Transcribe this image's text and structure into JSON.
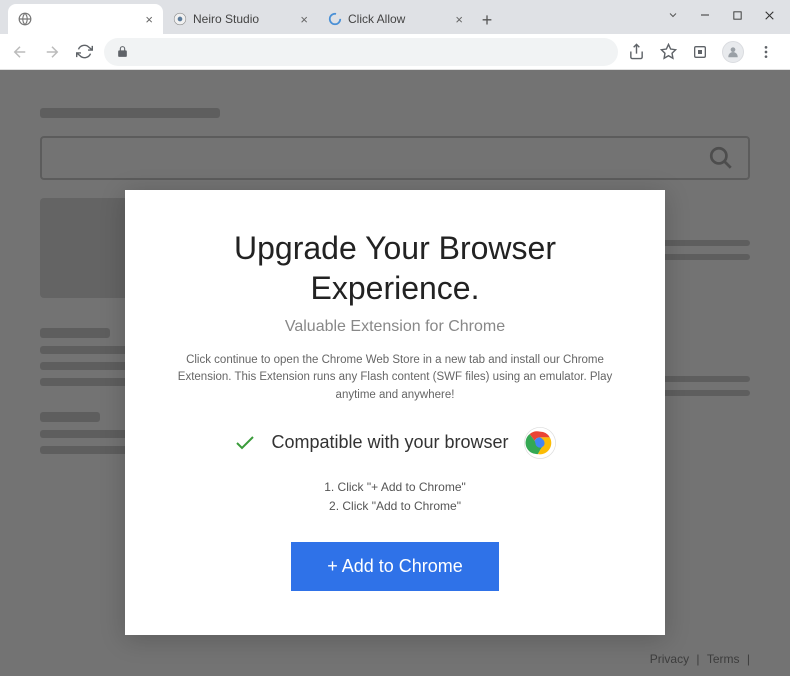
{
  "tabs": [
    {
      "title": "",
      "active": true
    },
    {
      "title": "Neiro Studio",
      "active": false
    },
    {
      "title": "Click Allow",
      "active": false
    }
  ],
  "modal": {
    "heading": "Upgrade Your Browser Experience.",
    "subheading": "Valuable Extension for Chrome",
    "description": "Click continue to open the Chrome Web Store in a new tab and install our Chrome Extension. This Extension runs any Flash content (SWF files) using an emulator. Play anytime and anywhere!",
    "compatible_text": "Compatible with your browser",
    "step1": "1. Click \"+ Add to Chrome\"",
    "step2": "2. Click \"Add to Chrome\"",
    "cta_label": "+ Add to Chrome"
  },
  "footer": {
    "privacy": "Privacy",
    "terms": "Terms"
  },
  "icons": {
    "globe": "globe-icon",
    "neiro": "neiro-favicon",
    "allow": "allow-favicon"
  }
}
